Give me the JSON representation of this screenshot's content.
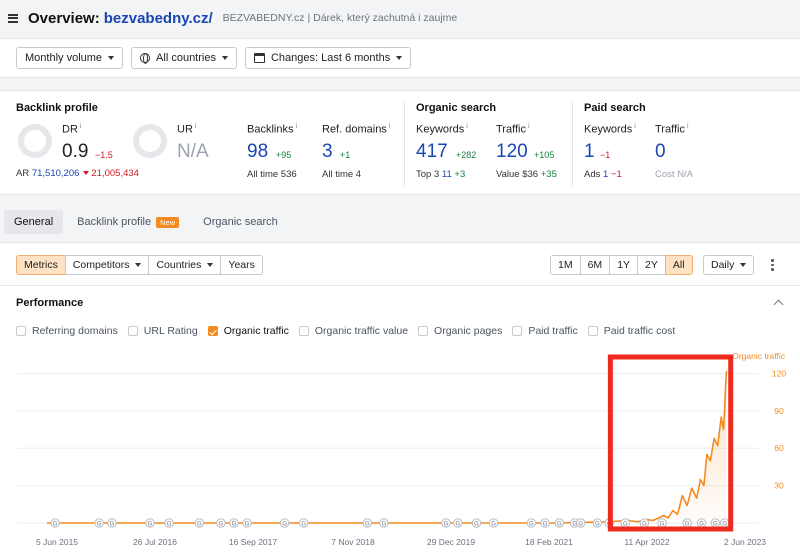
{
  "header": {
    "title": "Overview:",
    "domain": "bezvabedny.cz/",
    "subtitle": "BEZVABEDNY.cz | Dárek, který zachutná i zaujme"
  },
  "filters": {
    "volume": "Monthly volume",
    "country": "All countries",
    "changes": "Changes: Last 6 months"
  },
  "backlink_profile": {
    "title": "Backlink profile",
    "dr": {
      "label": "DR",
      "value": "0.9",
      "delta": "−1.5"
    },
    "ur": {
      "label": "UR",
      "value": "N/A"
    },
    "ar": {
      "label": "AR",
      "value": "71,510,206",
      "delta": "21,005,434"
    },
    "backlinks": {
      "label": "Backlinks",
      "value": "98",
      "delta": "+95",
      "alltime_label": "All time",
      "alltime": "536"
    },
    "ref_domains": {
      "label": "Ref. domains",
      "value": "3",
      "delta": "+1",
      "alltime_label": "All time",
      "alltime": "4"
    }
  },
  "organic_search": {
    "title": "Organic search",
    "keywords": {
      "label": "Keywords",
      "value": "417",
      "delta": "+282",
      "sub_label": "Top 3",
      "sub_value": "11",
      "sub_delta": "+3"
    },
    "traffic": {
      "label": "Traffic",
      "value": "120",
      "delta": "+105",
      "sub_label": "Value",
      "sub_value": "$36",
      "sub_delta": "+35"
    }
  },
  "paid_search": {
    "title": "Paid search",
    "keywords": {
      "label": "Keywords",
      "value": "1",
      "delta": "−1",
      "sub_label": "Ads",
      "sub_value": "1",
      "sub_delta": "−1"
    },
    "traffic": {
      "label": "Traffic",
      "value": "0",
      "sub_label": "Cost",
      "sub_value": "N/A"
    }
  },
  "tabs": [
    {
      "label": "General",
      "active": true
    },
    {
      "label": "Backlink profile",
      "badge": "New"
    },
    {
      "label": "Organic search"
    }
  ],
  "toolbar": {
    "left": [
      "Metrics",
      "Competitors",
      "Countries",
      "Years"
    ],
    "ranges": [
      "1M",
      "6M",
      "1Y",
      "2Y",
      "All"
    ],
    "interval": "Daily"
  },
  "performance": {
    "title": "Performance",
    "checkboxes": [
      {
        "label": "Referring domains",
        "checked": false
      },
      {
        "label": "URL Rating",
        "checked": false
      },
      {
        "label": "Organic traffic",
        "checked": true
      },
      {
        "label": "Organic traffic value",
        "checked": false
      },
      {
        "label": "Organic pages",
        "checked": false
      },
      {
        "label": "Paid traffic",
        "checked": false
      },
      {
        "label": "Paid traffic cost",
        "checked": false
      }
    ]
  },
  "colors": {
    "accent": "#f48b20",
    "link": "#1a46b3",
    "highlight_box": "#ee2a1f"
  },
  "chart_data": {
    "type": "line",
    "series": [
      {
        "name": "Organic traffic",
        "x": [
          "2015-06-05",
          "2021-06-01",
          "2022-01-01",
          "2022-04-01",
          "2022-05-15",
          "2022-06-15",
          "2022-07-15",
          "2022-08-10",
          "2022-09-01",
          "2022-09-20",
          "2022-10-10",
          "2022-10-30",
          "2022-11-20",
          "2022-12-10",
          "2022-12-30",
          "2023-01-20",
          "2023-02-05",
          "2023-02-20",
          "2023-03-05",
          "2023-03-20",
          "2023-04-05",
          "2023-04-20",
          "2023-05-05",
          "2023-05-15",
          "2023-05-20",
          "2023-05-24",
          "2023-05-28"
        ],
        "y": [
          0,
          0,
          1,
          2,
          1,
          3,
          2,
          4,
          6,
          4,
          10,
          7,
          22,
          14,
          28,
          20,
          35,
          30,
          55,
          50,
          68,
          62,
          85,
          75,
          90,
          110,
          122
        ]
      }
    ],
    "ylim": [
      0,
      130
    ],
    "yticks": [
      30,
      60,
      90,
      120
    ],
    "xticks": [
      "5 Jun 2015",
      "26 Jul 2016",
      "16 Sep 2017",
      "7 Nov 2018",
      "29 Dec 2019",
      "18 Feb 2021",
      "11 Apr 2022",
      "2 Jun 2023"
    ],
    "series_label": "Organic traffic",
    "marker_label": "G",
    "markers": [
      "2015-07-10",
      "2016-01-15",
      "2016-03-10",
      "2016-08-20",
      "2016-11-10",
      "2017-03-20",
      "2017-06-20",
      "2017-08-15",
      "2017-10-10",
      "2018-03-20",
      "2018-06-10",
      "2019-03-10",
      "2019-05-20",
      "2020-02-10",
      "2020-04-01",
      "2020-06-20",
      "2020-09-01",
      "2021-02-10",
      "2021-04-10",
      "2021-06-10",
      "2021-08-15",
      "2021-09-10",
      "2021-11-20",
      "2022-01-10",
      "2022-03-20",
      "2022-06-10",
      "2022-08-25",
      "2022-12-10",
      "2023-02-10",
      "2023-04-10",
      "2023-05-20"
    ],
    "grid": true,
    "highlight": {
      "start": "2022-01-15",
      "end": "2023-06-15"
    }
  }
}
